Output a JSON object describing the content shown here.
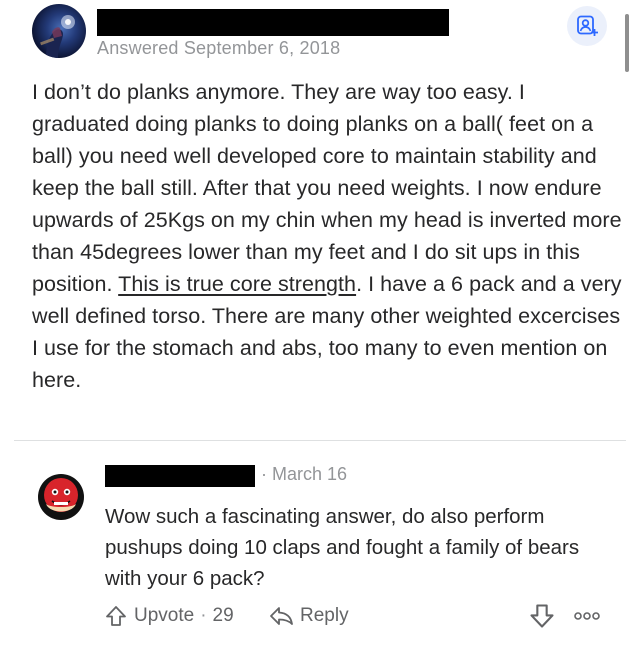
{
  "answer": {
    "meta": "Answered September 6, 2018",
    "text_before": "I don’t do planks anymore. They are way too easy. I graduated doing planks to doing planks on a ball( feet on a ball) you need well developed core to maintain stability and keep the ball still. After that you need weights. I now endure upwards of 25Kgs on my chin when my head is inverted more than 45degrees lower than my feet and I do sit ups in this position. ",
    "text_underlined": "This is true core strength",
    "text_after": ". I have a 6 pack and a very well defined torso. There are many other weighted excercises I use for the stomach and abs, too many to even mention on here."
  },
  "comment": {
    "date": "· March 16",
    "text": "Wow such a fascinating answer, do also perform pushups doing 10 claps and fought a family of bears with your 6 pack?",
    "upvote_label": "Upvote",
    "upvote_sep": "·",
    "upvote_count": "29",
    "reply_label": "Reply"
  },
  "icons": {
    "follow": "person-plus-icon",
    "upvote": "upvote-arrow-icon",
    "reply": "reply-arrow-icon",
    "downvote": "downvote-arrow-icon",
    "more": "more-dots-icon"
  },
  "colors": {
    "text": "#282829",
    "muted": "#939598",
    "action": "#636466",
    "accent": "#2e69ff",
    "follow_bg": "#ebf0fb"
  }
}
